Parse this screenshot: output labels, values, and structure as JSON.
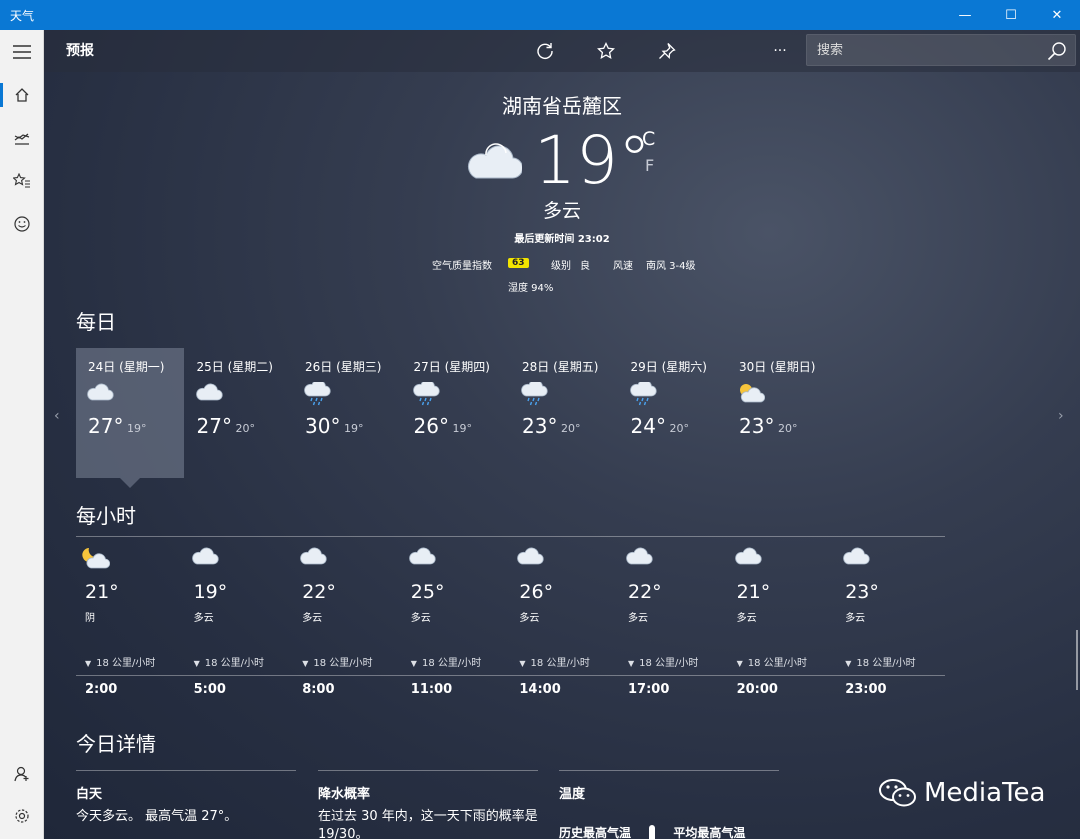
{
  "window": {
    "title": "天气",
    "minimize_glyph": "—",
    "maximize_glyph": "☐",
    "close_glyph": "✕"
  },
  "nav": {
    "items": [
      "menu-icon",
      "home-icon",
      "historical-chart-icon",
      "favorites-icon",
      "feedback-smiley-icon"
    ],
    "bottom": [
      "account-icon",
      "settings-icon"
    ]
  },
  "header": {
    "title": "预报",
    "more_label": "···",
    "search_placeholder": "搜索"
  },
  "current": {
    "location": "湖南省岳麓区",
    "temp": "19°",
    "unit_c": "C",
    "unit_f": "F",
    "condition": "多云",
    "updated": "最后更新时间 23:02",
    "aqi_label": "空气质量指数",
    "aqi_value": "63",
    "level_label": "级别",
    "level_value": "良",
    "wind_label": "风速",
    "wind_value": "南风 3-4级",
    "humidity": "湿度 94%"
  },
  "daily": {
    "title": "每日",
    "prev_arrow": "‹",
    "next_arrow": "›",
    "days": [
      {
        "date": "24日 (星期一)",
        "icon": "cloudy",
        "hi": "27°",
        "lo": "19°"
      },
      {
        "date": "25日 (星期二)",
        "icon": "cloudy",
        "hi": "27°",
        "lo": "20°"
      },
      {
        "date": "26日 (星期三)",
        "icon": "rain",
        "hi": "30°",
        "lo": "19°"
      },
      {
        "date": "27日 (星期四)",
        "icon": "rain",
        "hi": "26°",
        "lo": "19°"
      },
      {
        "date": "28日 (星期五)",
        "icon": "rain",
        "hi": "23°",
        "lo": "20°"
      },
      {
        "date": "29日 (星期六)",
        "icon": "rain",
        "hi": "24°",
        "lo": "20°"
      },
      {
        "date": "30日 (星期日)",
        "icon": "partly-sunny",
        "hi": "23°",
        "lo": "20°"
      }
    ]
  },
  "hourly": {
    "title": "每小时",
    "hours": [
      {
        "icon": "moon-cloud",
        "temp": "21°",
        "cond": "阴",
        "wind": "18 公里/小时",
        "time": "2:00"
      },
      {
        "icon": "cloudy",
        "temp": "19°",
        "cond": "多云",
        "wind": "18 公里/小时",
        "time": "5:00"
      },
      {
        "icon": "cloudy",
        "temp": "22°",
        "cond": "多云",
        "wind": "18 公里/小时",
        "time": "8:00"
      },
      {
        "icon": "cloudy",
        "temp": "25°",
        "cond": "多云",
        "wind": "18 公里/小时",
        "time": "11:00"
      },
      {
        "icon": "cloudy",
        "temp": "26°",
        "cond": "多云",
        "wind": "18 公里/小时",
        "time": "14:00"
      },
      {
        "icon": "cloudy",
        "temp": "22°",
        "cond": "多云",
        "wind": "18 公里/小时",
        "time": "17:00"
      },
      {
        "icon": "cloudy",
        "temp": "21°",
        "cond": "多云",
        "wind": "18 公里/小时",
        "time": "20:00"
      },
      {
        "icon": "cloudy",
        "temp": "23°",
        "cond": "多云",
        "wind": "18 公里/小时",
        "time": "23:00"
      }
    ]
  },
  "details": {
    "title": "今日详情",
    "day_head": "白天",
    "day_text": "今天多云。 最高气温 27°。",
    "precip_head": "降水概率",
    "precip_text": "在过去 30 年内，这一天下雨的概率是 19/30。",
    "temp_head": "温度",
    "temp_record_label": "历史最高气温",
    "temp_avg_label": "平均最高气温"
  },
  "watermark": "MediaTea"
}
